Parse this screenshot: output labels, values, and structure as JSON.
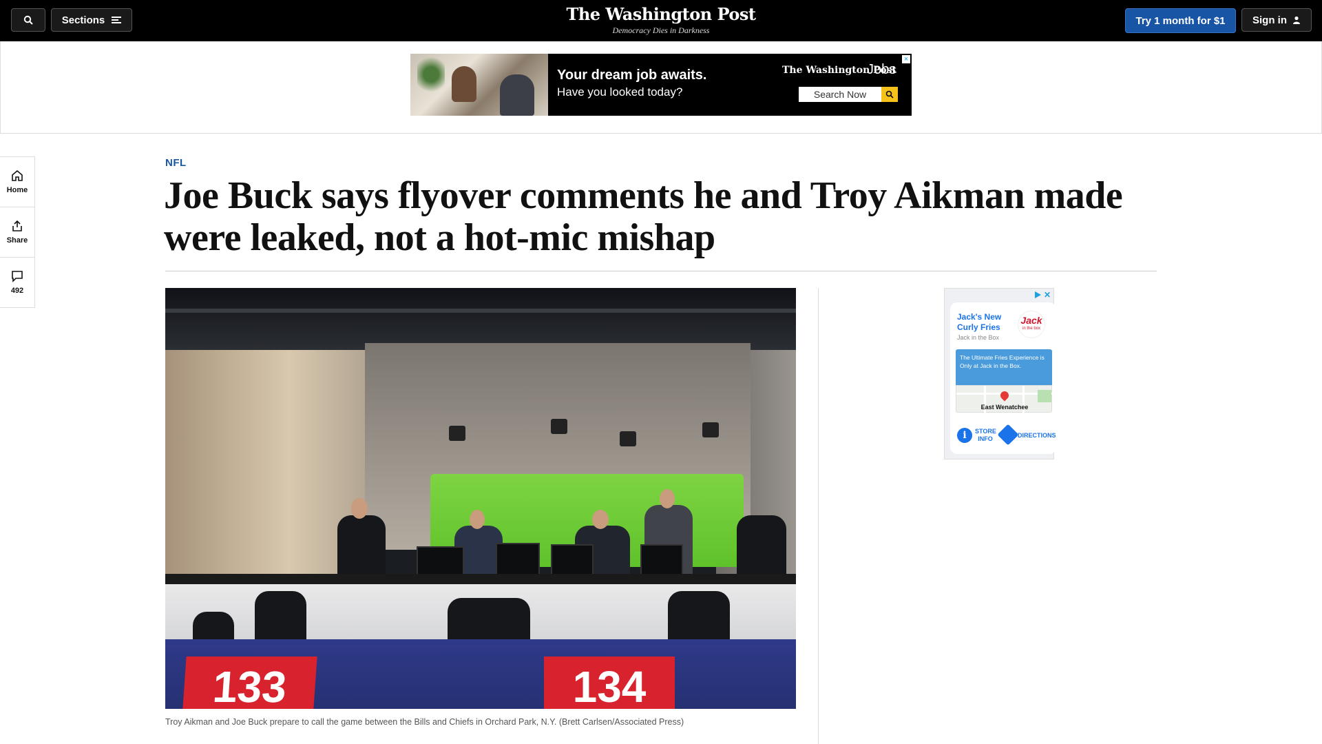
{
  "topnav": {
    "sections_label": "Sections",
    "logo": "The Washington Post",
    "tagline": "Democracy Dies in Darkness",
    "try_label": "Try 1 month for $1",
    "signin_label": "Sign in",
    "colors": {
      "bar": "#000000",
      "try_button": "#1955a5"
    }
  },
  "top_ad": {
    "headline": "Your dream job awaits.",
    "subline": "Have you looked today?",
    "brand": "The Washington Post",
    "brand_suffix": "Jobs",
    "search_label": "Search Now"
  },
  "rail": {
    "home": "Home",
    "share": "Share",
    "comments_count": "492"
  },
  "article": {
    "kicker": "NFL",
    "headline": "Joe Buck says flyover comments he and Troy Aikman made were leaked, not a hot-mic mishap",
    "photo_signs": [
      "133",
      "134"
    ],
    "caption": "Troy Aikman and Joe Buck prepare to call the game between the Bills and Chiefs in Orchard Park, N.Y. (Brett Carlsen/Associated Press)"
  },
  "side_ad": {
    "title": "Jack's New Curly Fries",
    "brand": "Jack in the Box",
    "logo_text": "Jack",
    "logo_small": "in the box",
    "blurb": "The Ultimate Fries Experience is Only at Jack in the Box.",
    "location": "East Wenatchee",
    "store_info": "STORE INFO",
    "directions": "DIRECTIONS"
  }
}
